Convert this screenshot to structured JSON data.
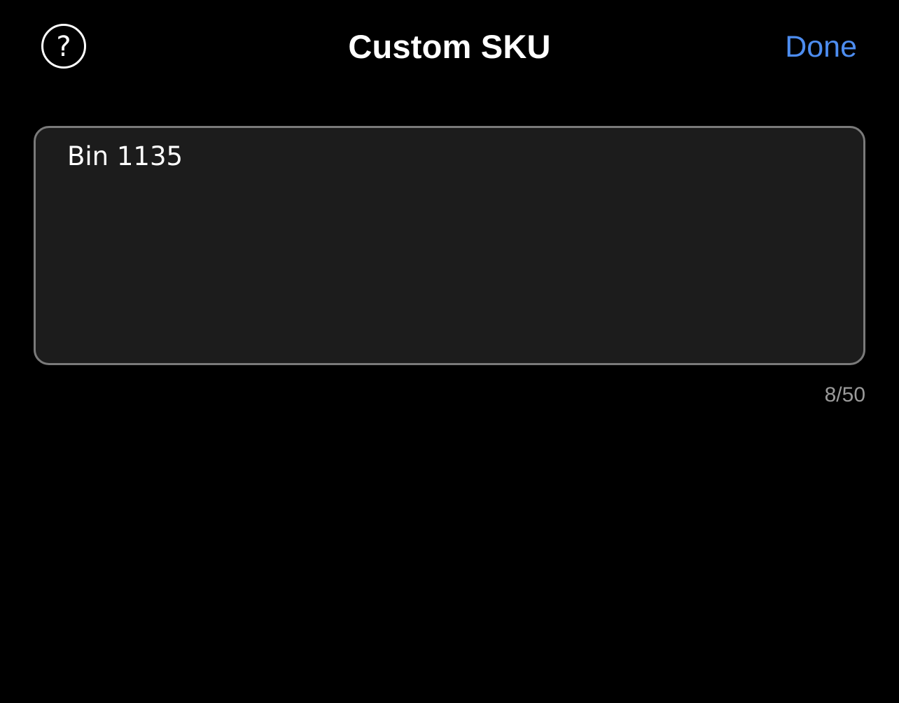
{
  "header": {
    "help_icon": "question-circle-icon",
    "help_glyph": "?",
    "title": "Custom SKU",
    "done_label": "Done"
  },
  "sku_field": {
    "value": "Bin 1135",
    "counter": "8/50"
  },
  "colors": {
    "background": "#000000",
    "accent": "#4d8df0",
    "field_background": "#1c1c1c",
    "field_border": "#7a7a7a",
    "counter_text": "#9a9a9a"
  }
}
